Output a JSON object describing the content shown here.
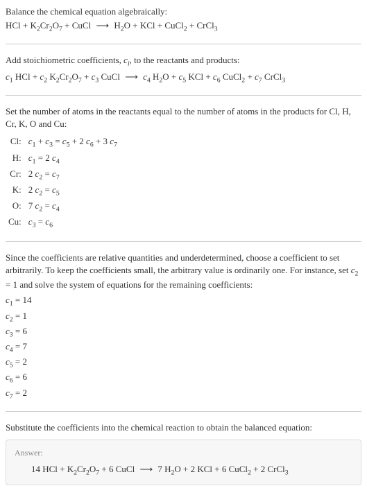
{
  "intro": {
    "line1": "Balance the chemical equation algebraically:",
    "equation": "HCl + K₂Cr₂O₇ + CuCl  ⟶  H₂O + KCl + CuCl₂ + CrCl₃"
  },
  "stoich": {
    "line1_prefix": "Add stoichiometric coefficients, ",
    "line1_ci": "cᵢ",
    "line1_suffix": ", to the reactants and products:",
    "equation": "c₁ HCl + c₂ K₂Cr₂O₇ + c₃ CuCl  ⟶  c₄ H₂O + c₅ KCl + c₆ CuCl₂ + c₇ CrCl₃"
  },
  "atoms": {
    "intro": "Set the number of atoms in the reactants equal to the number of atoms in the products for Cl, H, Cr, K, O and Cu:",
    "rows": [
      {
        "el": "Cl:",
        "eq": "c₁ + c₃ = c₅ + 2 c₆ + 3 c₇"
      },
      {
        "el": "H:",
        "eq": "c₁ = 2 c₄"
      },
      {
        "el": "Cr:",
        "eq": "2 c₂ = c₇"
      },
      {
        "el": "K:",
        "eq": "2 c₂ = c₅"
      },
      {
        "el": "O:",
        "eq": "7 c₂ = c₄"
      },
      {
        "el": "Cu:",
        "eq": "c₃ = c₆"
      }
    ]
  },
  "solve": {
    "intro": "Since the coefficients are relative quantities and underdetermined, choose a coefficient to set arbitrarily. To keep the coefficients small, the arbitrary value is ordinarily one. For instance, set c₂ = 1 and solve the system of equations for the remaining coefficients:",
    "coeffs": [
      "c₁ = 14",
      "c₂ = 1",
      "c₃ = 6",
      "c₄ = 7",
      "c₅ = 2",
      "c₆ = 6",
      "c₇ = 2"
    ]
  },
  "final": {
    "intro": "Substitute the coefficients into the chemical reaction to obtain the balanced equation:",
    "answer_label": "Answer:",
    "answer_equation": "14 HCl + K₂Cr₂O₇ + 6 CuCl  ⟶  7 H₂O + 2 KCl + 6 CuCl₂ + 2 CrCl₃"
  }
}
